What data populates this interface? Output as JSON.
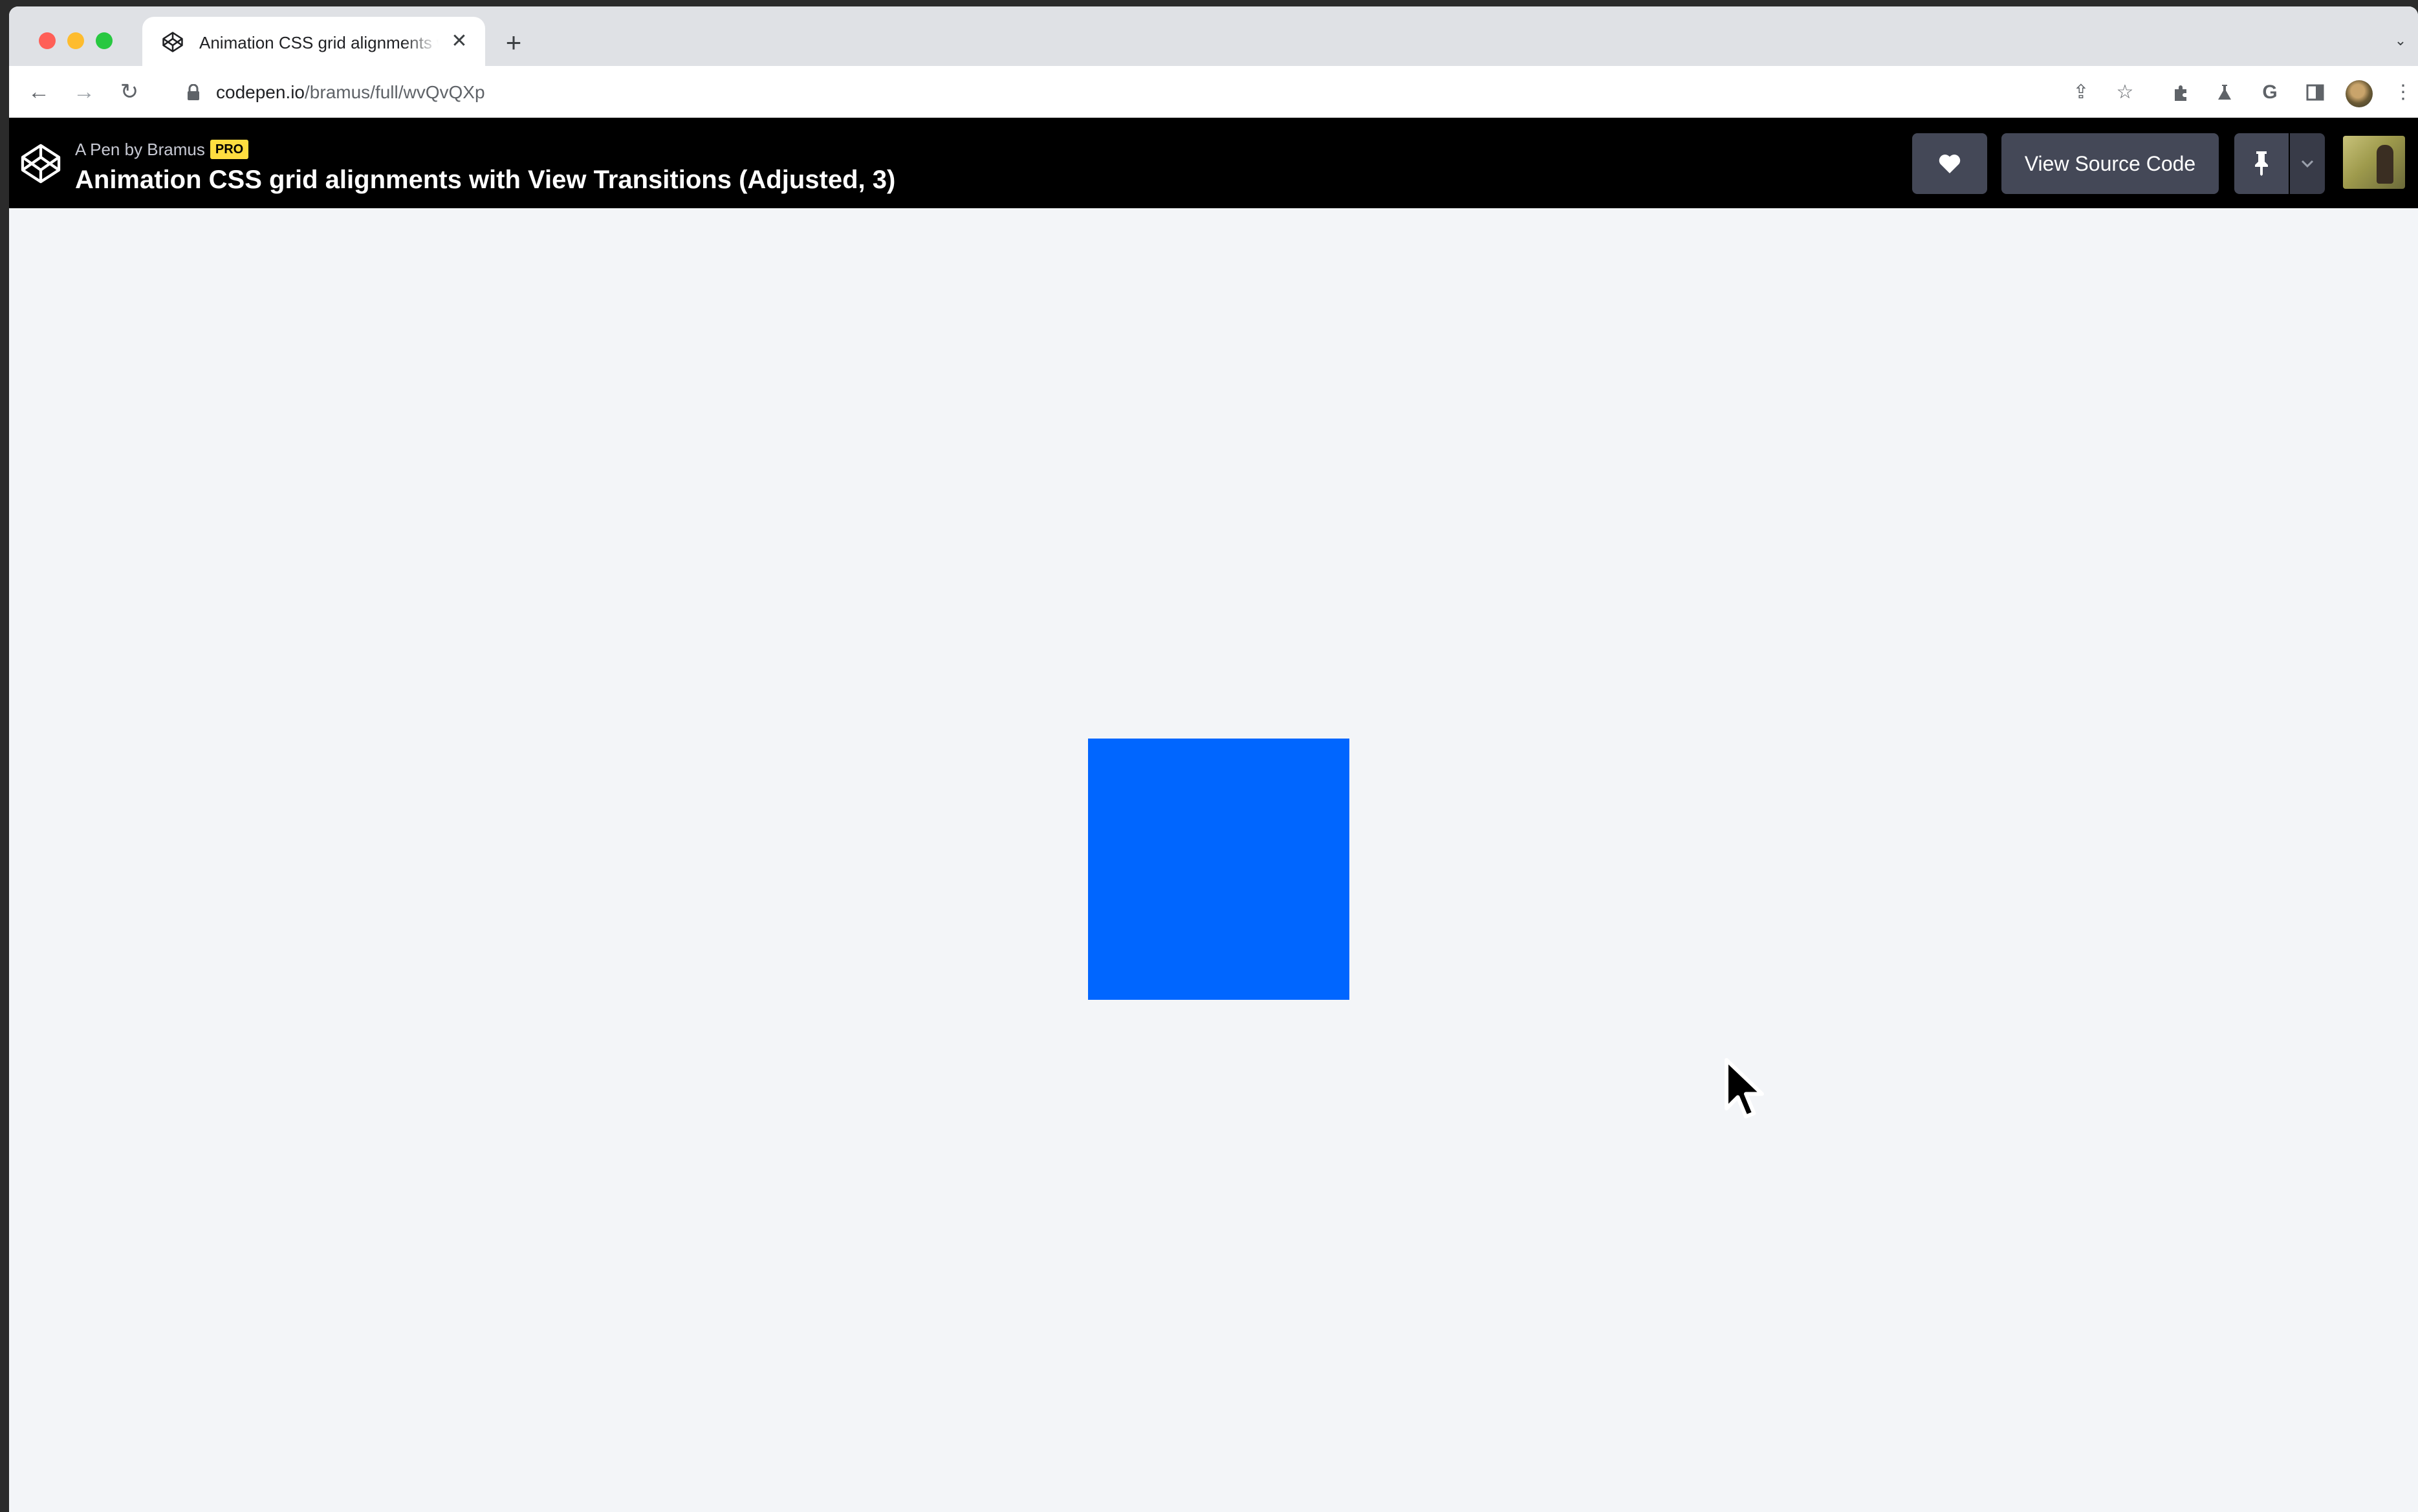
{
  "browser": {
    "tab": {
      "title": "Animation CSS grid alignments with View Transitions (Adjusted, 3)",
      "favicon": "codepen-icon",
      "close_icon": "close-icon"
    },
    "new_tab_label": "+",
    "url": {
      "domain": "codepen.io",
      "path": "/bramus/full/wvQvQXp"
    },
    "toolbar_icons": [
      "share-icon",
      "star-icon",
      "extensions-icon",
      "labs-icon",
      "google-icon",
      "sidepanel-icon",
      "profile-avatar",
      "menu-icon"
    ]
  },
  "codepen": {
    "byline": "A Pen by Bramus",
    "pro_badge": "PRO",
    "title": "Animation CSS grid alignments with View Transitions (Adjusted, 3)",
    "love_icon": "heart-icon",
    "view_source_label": "View Source Code",
    "pin_icon": "pin-icon"
  },
  "content": {
    "box_color": "#0066ff"
  }
}
